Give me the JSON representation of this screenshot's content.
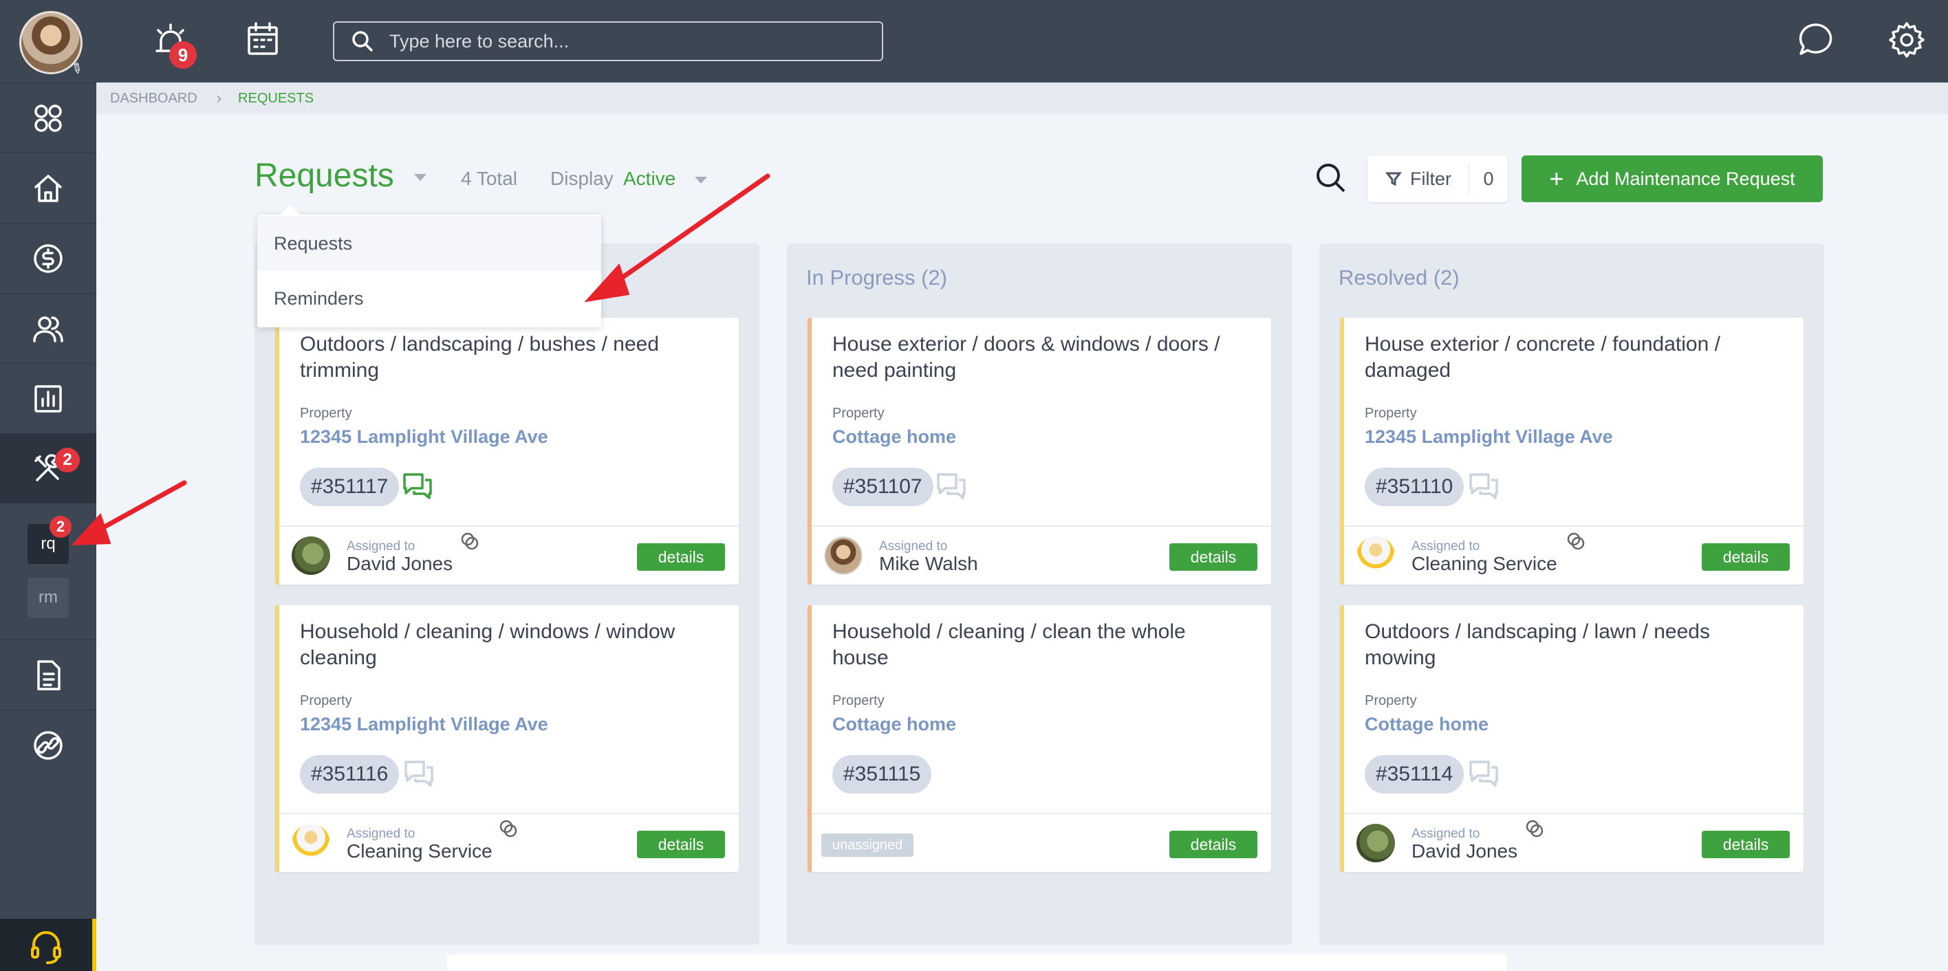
{
  "topbar": {
    "alarm_count": "9",
    "search_placeholder": "Type here to search..."
  },
  "sidebar": {
    "maintenance_badge": "2",
    "sub_items": [
      {
        "label": "rq",
        "badge": "2"
      },
      {
        "label": "rm"
      }
    ]
  },
  "breadcrumb": {
    "items": [
      "DASHBOARD",
      "REQUESTS"
    ],
    "separator": "›"
  },
  "header": {
    "title": "Requests",
    "total": "4 Total",
    "display_label": "Display",
    "display_value": "Active",
    "filter_label": "Filter",
    "filter_count": "0",
    "add_button": "Add Maintenance Request"
  },
  "dropdown": {
    "items": [
      "Requests",
      "Reminders"
    ]
  },
  "columns": [
    {
      "title": "",
      "cards": [
        {
          "title": "Outdoors / landscaping / bushes / need trimming",
          "property_label": "Property",
          "property": "12345 Lamplight Village Ave",
          "id": "#351117",
          "chat": "green",
          "assigned_label": "Assigned to",
          "assignee": "David Jones",
          "button": "details"
        },
        {
          "title": "Household / cleaning / windows / window cleaning",
          "property_label": "Property",
          "property": "12345 Lamplight Village Ave",
          "id": "#351116",
          "chat": "grey",
          "assigned_label": "Assigned to",
          "assignee": "Cleaning Service",
          "button": "details"
        }
      ]
    },
    {
      "title": "In Progress (2)",
      "cards": [
        {
          "title": "House exterior / doors & windows / doors / need painting",
          "property_label": "Property",
          "property": "Cottage home",
          "id": "#351107",
          "chat": "grey",
          "assigned_label": "Assigned to",
          "assignee": "Mike Walsh",
          "button": "details"
        },
        {
          "title": "Household / cleaning / clean the whole house",
          "property_label": "Property",
          "property": "Cottage home",
          "id": "#351115",
          "chat": "none",
          "unassigned": "unassigned",
          "button": "details"
        }
      ]
    },
    {
      "title": "Resolved (2)",
      "cards": [
        {
          "title": "House exterior / concrete / foundation / damaged",
          "property_label": "Property",
          "property": "12345 Lamplight Village Ave",
          "id": "#351110",
          "chat": "grey",
          "assigned_label": "Assigned to",
          "assignee": "Cleaning Service",
          "button": "details"
        },
        {
          "title": "Outdoors / landscaping / lawn / needs mowing",
          "property_label": "Property",
          "property": "Cottage home",
          "id": "#351114",
          "chat": "grey",
          "assigned_label": "Assigned to",
          "assignee": "David Jones",
          "button": "details"
        }
      ]
    }
  ],
  "colors": {
    "accent_green": "#3ea33e",
    "sidebar": "#3d4653",
    "badge_red": "#e2363f",
    "annotation_arrow": "#e8232c"
  }
}
